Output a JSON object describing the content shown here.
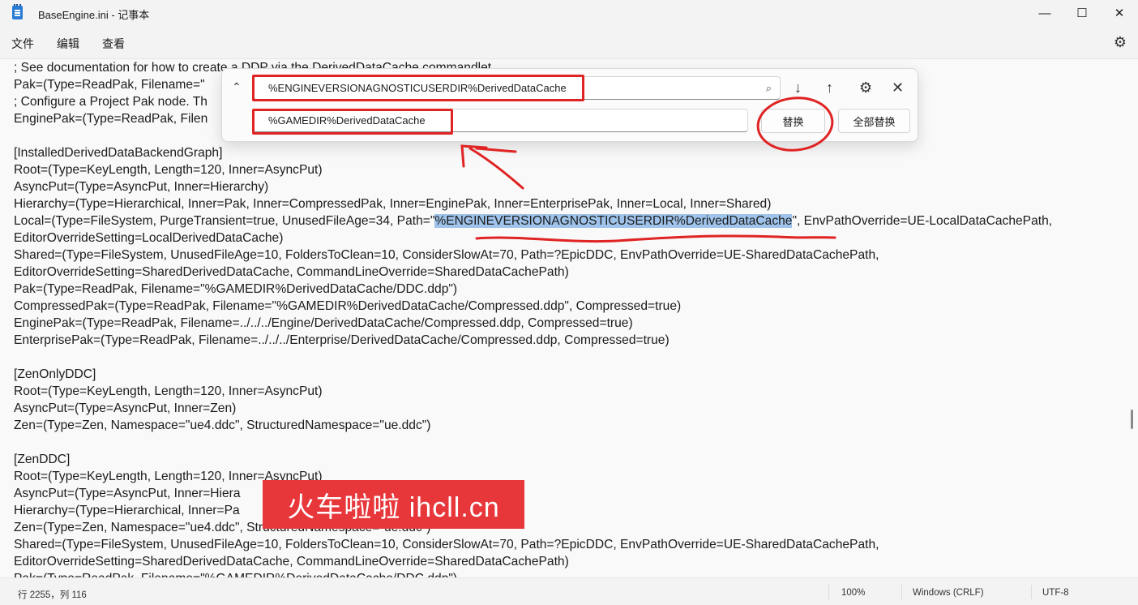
{
  "window": {
    "title": "BaseEngine.ini - 记事本",
    "minimize": "—",
    "maximize": "☐",
    "close": "✕"
  },
  "menu": {
    "file": "文件",
    "edit": "编辑",
    "view": "查看",
    "settings_icon": "⚙"
  },
  "editor": {
    "lines": [
      "; See documentation for how to create a DDP via the DerivedDataCache commandlet.",
      "Pak=(Type=ReadPak, Filename=\"",
      "; Configure a Project Pak node. Th",
      "EnginePak=(Type=ReadPak, Filen",
      "",
      "[InstalledDerivedDataBackendGraph]",
      "Root=(Type=KeyLength, Length=120, Inner=AsyncPut)",
      "AsyncPut=(Type=AsyncPut, Inner=Hierarchy)",
      "Hierarchy=(Type=Hierarchical, Inner=Pak, Inner=CompressedPak, Inner=EnginePak, Inner=EnterprisePak, Inner=Local, Inner=Shared)",
      "",
      "EditorOverrideSetting=LocalDerivedDataCache)",
      "Shared=(Type=FileSystem, UnusedFileAge=10, FoldersToClean=10, ConsiderSlowAt=70, Path=?EpicDDC, EnvPathOverride=UE-SharedDataCachePath,",
      "EditorOverrideSetting=SharedDerivedDataCache, CommandLineOverride=SharedDataCachePath)",
      "Pak=(Type=ReadPak, Filename=\"%GAMEDIR%DerivedDataCache/DDC.ddp\")",
      "CompressedPak=(Type=ReadPak, Filename=\"%GAMEDIR%DerivedDataCache/Compressed.ddp\", Compressed=true)",
      "EnginePak=(Type=ReadPak, Filename=../../../Engine/DerivedDataCache/Compressed.ddp, Compressed=true)",
      "EnterprisePak=(Type=ReadPak, Filename=../../../Enterprise/DerivedDataCache/Compressed.ddp, Compressed=true)",
      "",
      "[ZenOnlyDDC]",
      "Root=(Type=KeyLength, Length=120, Inner=AsyncPut)",
      "AsyncPut=(Type=AsyncPut, Inner=Zen)",
      "Zen=(Type=Zen, Namespace=\"ue4.ddc\", StructuredNamespace=\"ue.ddc\")",
      "",
      "[ZenDDC]",
      "Root=(Type=KeyLength, Length=120, Inner=AsyncPut)",
      "AsyncPut=(Type=AsyncPut, Inner=Hiera",
      "Hierarchy=(Type=Hierarchical, Inner=Pa                                                 ared)",
      "Zen=(Type=Zen, Namespace=\"ue4.ddc\", StructuredNamespace=\"ue.ddc\")",
      "Shared=(Type=FileSystem, UnusedFileAge=10, FoldersToClean=10, ConsiderSlowAt=70, Path=?EpicDDC, EnvPathOverride=UE-SharedDataCachePath,",
      "EditorOverrideSetting=SharedDerivedDataCache, CommandLineOverride=SharedDataCachePath)",
      "Pak=(Type=ReadPak, Filename=\"%GAMEDIR%DerivedDataCache/DDC.ddp\")"
    ],
    "local_line_prefix": "Local=(Type=FileSystem, PurgeTransient=true, UnusedFileAge=34, Path=\"",
    "local_line_match": "%ENGINEVERSIONAGNOSTICUSERDIR%DerivedDataCache",
    "local_line_suffix": "\", EnvPathOverride=UE-LocalDataCachePath,"
  },
  "find_replace": {
    "find_value": "%ENGINEVERSIONAGNOSTICUSERDIR%DerivedDataCache",
    "replace_value": "%GAMEDIR%DerivedDataCache",
    "replace_button": "替换",
    "replace_all_button": "全部替换",
    "icons": {
      "collapse": "⌃",
      "search": "⌕",
      "next": "↓",
      "previous": "↑",
      "options": "⚙",
      "close": "✕"
    }
  },
  "status": {
    "position": "行 2255，列 116",
    "zoom": "100%",
    "line_ending": "Windows (CRLF)",
    "encoding": "UTF-8"
  },
  "watermark": {
    "text": "火车啦啦 ihcll.cn"
  },
  "colors": {
    "highlight": "#9fc3ea",
    "annotation_red": "#e02323",
    "watermark_bg": "#e8373b"
  }
}
